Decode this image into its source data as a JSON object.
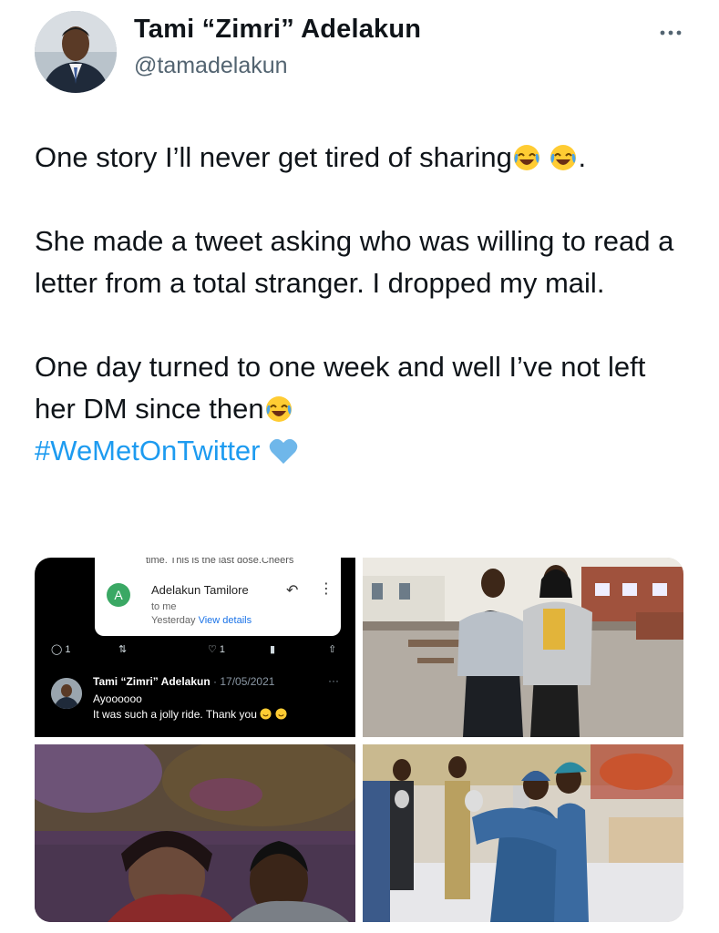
{
  "user": {
    "display_name": "Tami “Zimri” Adelakun",
    "handle": "@tamadelakun"
  },
  "tweet": {
    "line1": "One story I’ll never get tired of sharing",
    "line1_end": ".",
    "para2": "She made a tweet asking who was willing to read a letter from a total stranger. I dropped my mail.",
    "para3": "One day turned to one week and well I’ve not left her DM since then",
    "hashtag": "#WeMetOnTwitter"
  },
  "media": {
    "screenshot": {
      "email_cutoff": "time. This is the last dose.Cheers",
      "email_avatar_letter": "A",
      "email_from": "Adelakun Tamilore",
      "email_to": "to me",
      "email_when": "Yesterday",
      "email_details_link": "View details",
      "reply_count": "1",
      "like_count": "1",
      "reply_name": "Tami “Zimri” Adelakun",
      "reply_date": "· 17/05/2021",
      "reply_line1": "Ayoooooo",
      "reply_line2": "It was such a jolly ride. Thank you"
    }
  },
  "icons": [
    "more-icon",
    "laugh-cry-emoji",
    "blue-heart-emoji",
    "reply-icon",
    "retweet-icon",
    "like-icon",
    "stats-icon",
    "share-icon",
    "email-reply-icon",
    "kebab-icon",
    "smile-emoji"
  ]
}
